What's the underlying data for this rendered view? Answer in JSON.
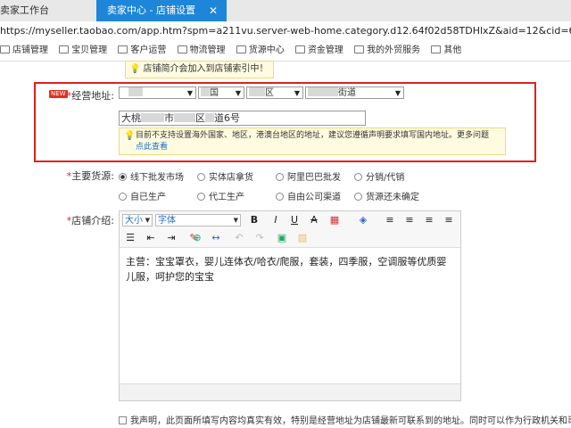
{
  "browser": {
    "tabs": [
      {
        "label": "卖家工作台"
      },
      {
        "label": "卖家中心 - 店铺设置",
        "close": "✕"
      }
    ],
    "url": "https://myseller.taobao.com/app.htm?spm=a211vu.server-web-home.category.d12.64f02d58TDHlxZ&aid=12&cid=64",
    "bookmarks": [
      "店铺管理",
      "宝贝管理",
      "客户运营",
      "物流管理",
      "货源中心",
      "资金管理",
      "我的外贸服务",
      "其他"
    ]
  },
  "form": {
    "top_notice": "店铺简介会加入到店铺索引中！",
    "address": {
      "new_tag": "NEW",
      "label": "经营地址:",
      "required_mark": "*",
      "province_suffix": "",
      "city_suffix": "",
      "city_suffix2": "",
      "district_suffix": "区",
      "street_suffix": "街道",
      "city_visible": "",
      "city_visible2": "",
      "district_visible": "",
      "street_visible": "",
      "city_text": "",
      "detail_parts": [
        "大桃",
        "市",
        "区",
        "道6号"
      ],
      "warning_text": "目前不支持设置海外国家、地区，港澳台地区的地址，建议您遵循声明要求填写国内地址。更多问题",
      "warning_link": "点此查看"
    },
    "source": {
      "label": "主要货源:",
      "required_mark": "*",
      "options": [
        {
          "label": "线下批发市场",
          "checked": true
        },
        {
          "label": "实体店拿货",
          "checked": false
        },
        {
          "label": "阿里巴巴批发",
          "checked": false
        },
        {
          "label": "分销/代销",
          "checked": false
        },
        {
          "label": "自已生产",
          "checked": false
        },
        {
          "label": "代工生产",
          "checked": false
        },
        {
          "label": "自由公司渠道",
          "checked": false
        },
        {
          "label": "货源还未确定",
          "checked": false
        }
      ]
    },
    "intro": {
      "label": "店铺介绍:",
      "required_mark": "*",
      "size_select": "大小",
      "font_select": "字体",
      "toolbar_row1": [
        "B",
        "I",
        "U",
        "A",
        "▦",
        "◈",
        "≡",
        "≡",
        "≡",
        "≡"
      ],
      "toolbar_row2": [
        "☰",
        "⇤",
        "⇥",
        "✎",
        "⊕",
        "↔",
        "↶",
        "↷",
        "▣",
        "▧"
      ],
      "content": "主营：宝宝罩衣，婴儿连体衣/哈衣/爬服，套装，四季服，空调服等优质婴儿服，呵护您的宝宝"
    },
    "declaration": "我声明，此页面所填写内容均真实有效，特别是经营地址为店铺最新可联系到的地址。同时可以作为行政机关和司法机关送达"
  }
}
